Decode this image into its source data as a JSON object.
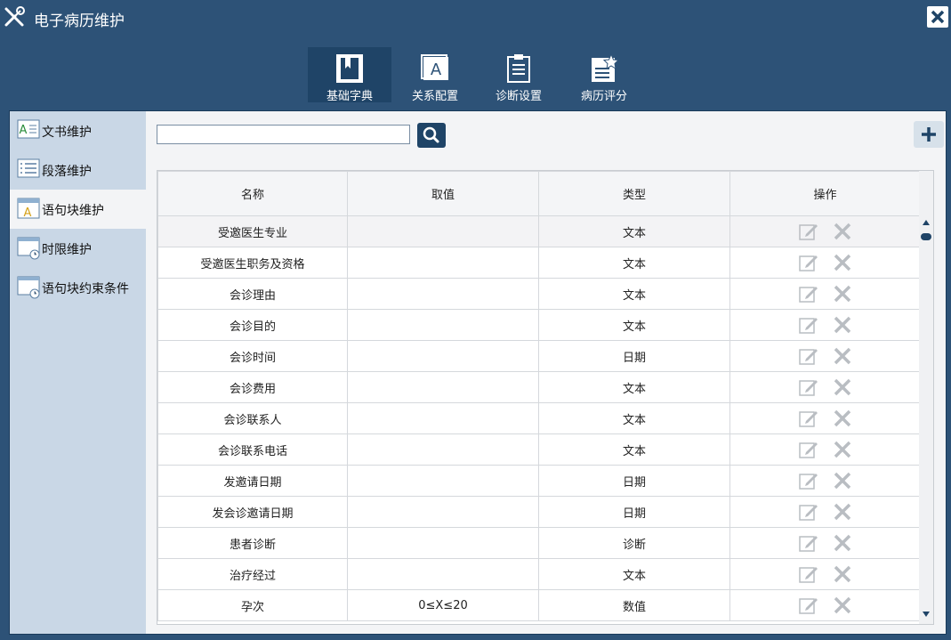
{
  "window": {
    "title": "电子病历维护",
    "close_icon": "close-icon"
  },
  "toolbar": [
    {
      "label": "基础字典",
      "icon": "book-icon",
      "active": true
    },
    {
      "label": "关系配置",
      "icon": "text-frame-icon",
      "active": false
    },
    {
      "label": "诊断设置",
      "icon": "clipboard-icon",
      "active": false
    },
    {
      "label": "病历评分",
      "icon": "star-list-icon",
      "active": false
    }
  ],
  "sidebar": {
    "items": [
      {
        "label": "文书维护",
        "icon": "document-text-icon",
        "active": false
      },
      {
        "label": "段落维护",
        "icon": "paragraph-list-icon",
        "active": false
      },
      {
        "label": "语句块维护",
        "icon": "sentence-block-icon",
        "active": true
      },
      {
        "label": "时限维护",
        "icon": "time-limit-icon",
        "active": false
      },
      {
        "label": "语句块约束条件",
        "icon": "constraint-icon",
        "active": false
      }
    ]
  },
  "search": {
    "value": "",
    "placeholder": "",
    "button_icon": "search-icon"
  },
  "add_button_icon": "plus-icon",
  "table": {
    "headers": [
      "名称",
      "取值",
      "类型",
      "操作"
    ],
    "rows": [
      [
        "受邀医生专业",
        "",
        "文本"
      ],
      [
        "受邀医生职务及资格",
        "",
        "文本"
      ],
      [
        "会诊理由",
        "",
        "文本"
      ],
      [
        "会诊目的",
        "",
        "文本"
      ],
      [
        "会诊时间",
        "",
        "日期"
      ],
      [
        "会诊费用",
        "",
        "文本"
      ],
      [
        "会诊联系人",
        "",
        "文本"
      ],
      [
        "会诊联系电话",
        "",
        "文本"
      ],
      [
        "发邀请日期",
        "",
        "日期"
      ],
      [
        "发会诊邀请日期",
        "",
        "日期"
      ],
      [
        "患者诊断",
        "",
        "诊断"
      ],
      [
        "治疗经过",
        "",
        "文本"
      ],
      [
        "孕次",
        "0≤X≤20",
        "数值"
      ]
    ]
  },
  "colors": {
    "titlebar": "#2d5277",
    "accent": "#1f4467",
    "sidebar": "#c9d7e6"
  }
}
